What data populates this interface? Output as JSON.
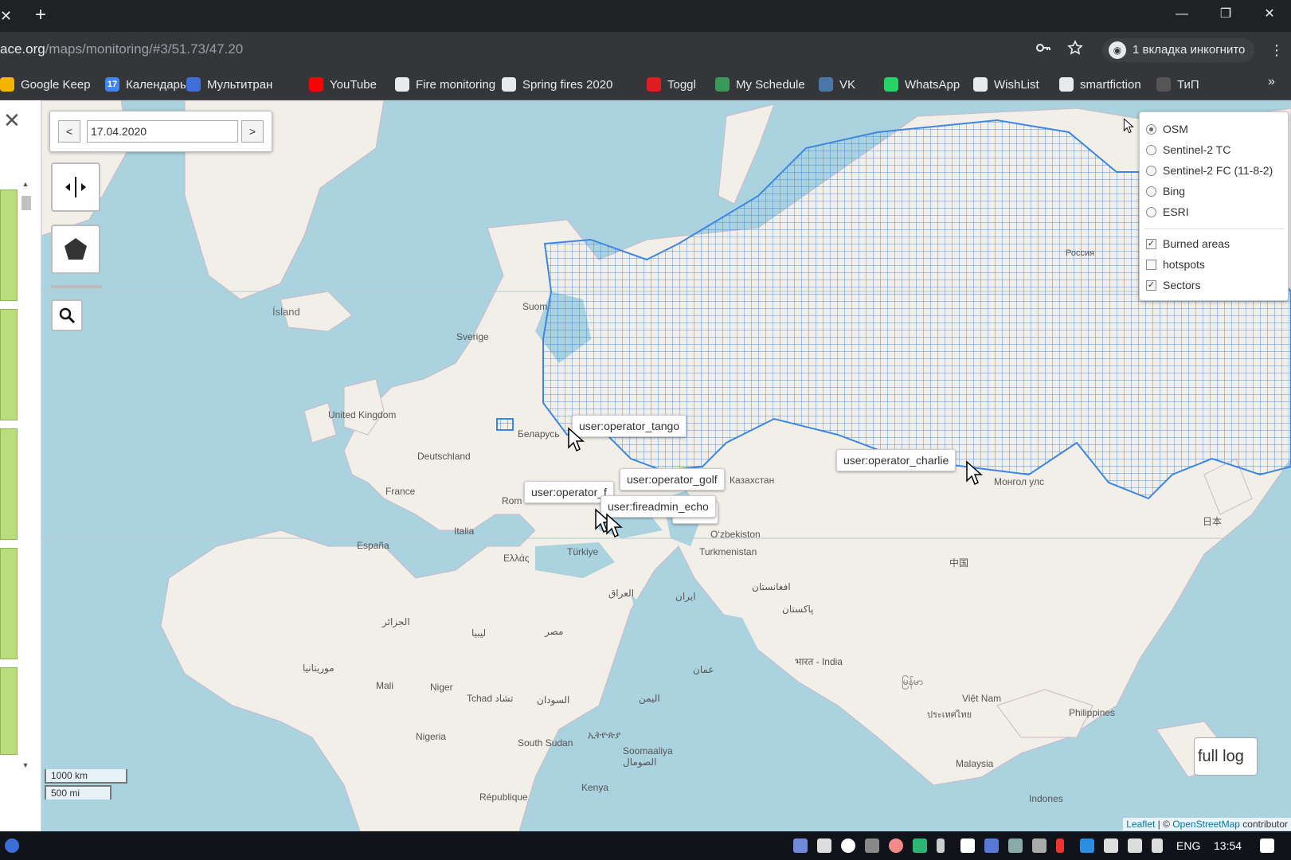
{
  "browser": {
    "tab_close": "✕",
    "new_tab": "+",
    "window": {
      "minimize": "—",
      "restore": "❐",
      "close": "✕"
    },
    "url_domain": "ace.org",
    "url_path": "/maps/monitoring/#3/51.73/47.20",
    "incognito_label": "1 вкладка инкогнито",
    "icons": [
      "key-icon",
      "star-icon",
      "incognito-icon",
      "menu-icon"
    ]
  },
  "bookmarks": [
    {
      "label": "Google Keep",
      "icon": "google-keep-icon",
      "color": "#f4b400"
    },
    {
      "label": "Календарь",
      "icon": "calendar-icon",
      "color": "#4285f4",
      "glyph": "17"
    },
    {
      "label": "Мультитран",
      "icon": "multitran-icon",
      "color": "#3f6fd8"
    },
    {
      "label": "YouTube",
      "icon": "youtube-icon",
      "color": "#ff0000"
    },
    {
      "label": "Fire monitoring",
      "icon": "globe-icon",
      "color": "#e8eaed"
    },
    {
      "label": "Spring fires 2020",
      "icon": "globe-icon",
      "color": "#e8eaed"
    },
    {
      "label": "Toggl",
      "icon": "toggl-icon",
      "color": "#e01b22"
    },
    {
      "label": "My Schedule",
      "icon": "schedule-icon",
      "color": "#3a9a5c"
    },
    {
      "label": "VK",
      "icon": "vk-icon",
      "color": "#4a76a8"
    },
    {
      "label": "WhatsApp",
      "icon": "whatsapp-icon",
      "color": "#25d366"
    },
    {
      "label": "WishList",
      "icon": "globe-icon",
      "color": "#e8eaed"
    },
    {
      "label": "smartfiction",
      "icon": "globe-icon",
      "color": "#e8eaed"
    },
    {
      "label": "ТиП",
      "icon": "tip-icon",
      "color": "#555"
    }
  ],
  "bookmarks_more": "»",
  "map": {
    "date": "17.04.2020",
    "prev": "<",
    "next": ">",
    "layers": {
      "base": [
        {
          "label": "OSM",
          "selected": true
        },
        {
          "label": "Sentinel-2 TC",
          "selected": false
        },
        {
          "label": "Sentinel-2 FC (11-8-2)",
          "selected": false
        },
        {
          "label": "Bing",
          "selected": false
        },
        {
          "label": "ESRI",
          "selected": false
        }
      ],
      "overlays": [
        {
          "label": "Burned areas",
          "checked": true
        },
        {
          "label": "hotspots",
          "checked": false
        },
        {
          "label": "Sectors",
          "checked": true
        }
      ]
    },
    "tooltips": {
      "tango": "user:operator_tango",
      "charlie": "user:operator_charlie",
      "golf": "user:operator_golf",
      "partial": "user:operator_f",
      "echo": "user:fireadmin_echo",
      "hidden_tail": "a"
    },
    "places": {
      "island": "Ísland",
      "sverige": "Sverige",
      "suomi": "Suom",
      "uk": "United Kingdom",
      "belarus": "Беларусь",
      "deutschland": "Deutschland",
      "france": "France",
      "roma": "Rom",
      "italia": "Italia",
      "espana": "España",
      "ellas": "Ελλάς",
      "turkiye": "Türkiye",
      "kazakhstan": "Казахстан",
      "uzbekistan": "O‘zbekiston",
      "turkmenistan": "Turkmenistan",
      "rossiya": "Россия",
      "mongol": "Монгол улс",
      "china": "中国",
      "japan": "日本",
      "iraq": "العراق",
      "iran": "ایران",
      "afghanistan": "افغانستان",
      "pakistan": "پاکستان",
      "algeria": "الجزائر",
      "libya": "ليبيا",
      "egypt": "مصر",
      "mauritania": "موريتانيا",
      "mali": "Mali",
      "niger": "Niger",
      "chad": "Tchad تشاد",
      "sudan": "السودان",
      "yemen": "اليمن",
      "oman": "عمان",
      "india": "भारत - India",
      "myanmar": "မြန်မာ",
      "vietnam": "Việt Nam",
      "thailand": "ประเทศไทย",
      "philippines": "Philippines",
      "nigeria": "Nigeria",
      "ethiopia": "ኢትዮጵያ",
      "south_sudan": "South Sudan",
      "somalia": "Soomaaliya الصومال",
      "kenya": "Kenya",
      "rdc": "République",
      "malaysia": "Malaysia",
      "indonesia": "Indones"
    },
    "scale_km": "1000 km",
    "scale_mi": "500 mi",
    "attribution_leaflet": "Leaflet",
    "attribution_sep": " | © ",
    "attribution_osm": "OpenStreetMap",
    "attribution_tail": " contributor",
    "full_log": "full log"
  },
  "taskbar": {
    "lang": "ENG",
    "time": "13:54"
  }
}
